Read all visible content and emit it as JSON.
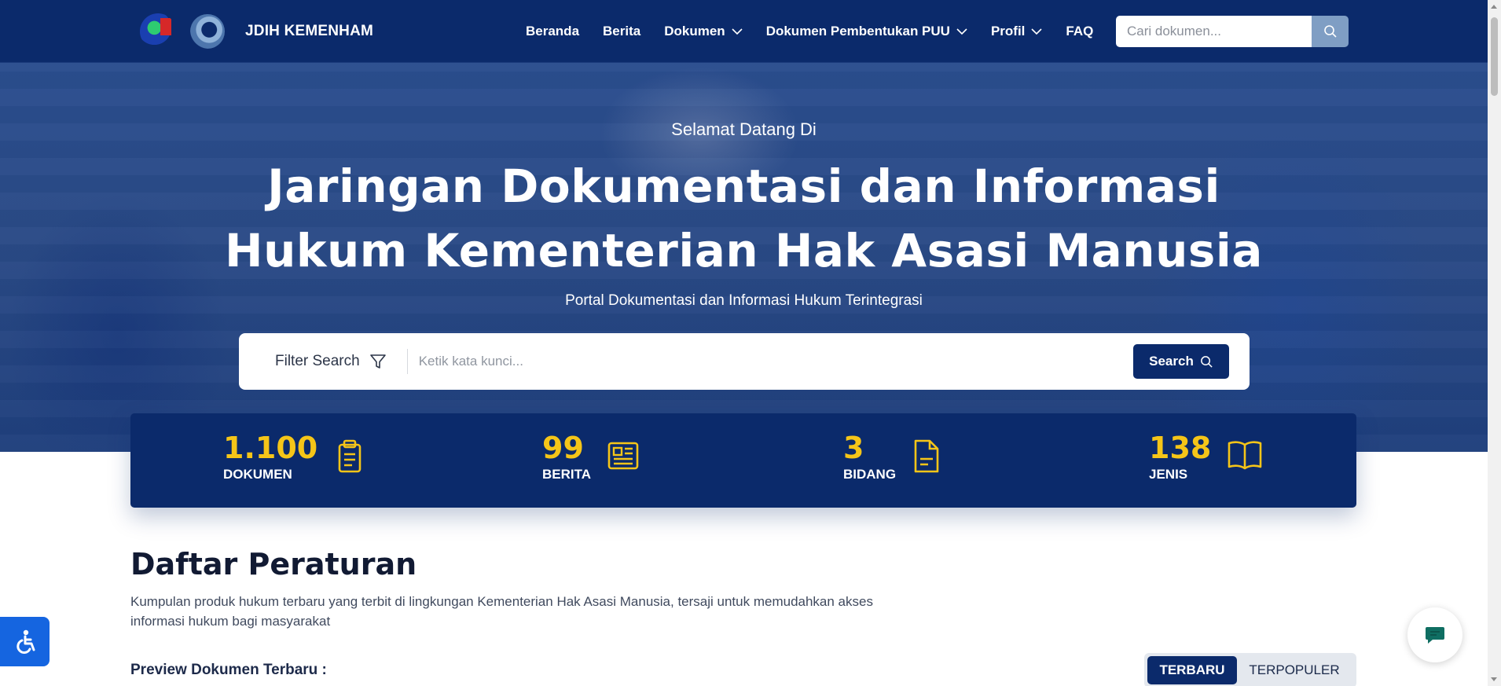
{
  "header": {
    "site_name": "JDIH KEMENHAM",
    "nav": [
      {
        "label": "Beranda",
        "has_dropdown": false
      },
      {
        "label": "Berita",
        "has_dropdown": false
      },
      {
        "label": "Dokumen",
        "has_dropdown": true
      },
      {
        "label": "Dokumen Pembentukan PUU",
        "has_dropdown": true
      },
      {
        "label": "Profil",
        "has_dropdown": true
      },
      {
        "label": "FAQ",
        "has_dropdown": false
      }
    ],
    "search_placeholder": "Cari dokumen..."
  },
  "hero": {
    "welcome": "Selamat Datang Di",
    "title_line1": "Jaringan Dokumentasi dan Informasi",
    "title_line2": "Hukum Kementerian Hak Asasi Manusia",
    "subtitle": "Portal Dokumentasi dan Informasi Hukum Terintegrasi",
    "filter_label": "Filter Search",
    "search_placeholder": "Ketik kata kunci...",
    "search_button": "Search"
  },
  "stats": [
    {
      "value": "1.100",
      "label": "DOKUMEN",
      "icon": "clipboard-icon"
    },
    {
      "value": "99",
      "label": "BERITA",
      "icon": "newspaper-icon"
    },
    {
      "value": "3",
      "label": "BIDANG",
      "icon": "document-icon"
    },
    {
      "value": "138",
      "label": "JENIS",
      "icon": "open-book-icon"
    }
  ],
  "section": {
    "title": "Daftar Peraturan",
    "description": "Kumpulan produk hukum terbaru yang terbit di lingkungan Kementerian Hak Asasi Manusia, tersaji untuk memudahkan akses informasi hukum bagi masyarakat",
    "preview_label": "Preview Dokumen Terbaru :",
    "tabs": [
      {
        "label": "TERBARU",
        "active": true
      },
      {
        "label": "TERPOPULER",
        "active": false
      }
    ]
  },
  "colors": {
    "primary": "#0b2a6b",
    "accent": "#f5c518",
    "a11y": "#1565e0",
    "chat": "#0f6e62"
  }
}
